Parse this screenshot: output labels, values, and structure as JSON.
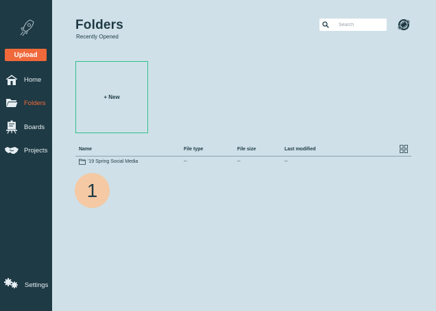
{
  "sidebar": {
    "logo": "rocket-icon",
    "upload_label": "Upload",
    "items": [
      {
        "label": "Home",
        "icon": "home-icon"
      },
      {
        "label": "Folders",
        "icon": "folder-icon",
        "active": true
      },
      {
        "label": "Boards",
        "icon": "board-icon"
      },
      {
        "label": "Projects",
        "icon": "handshake-icon"
      }
    ],
    "settings_label": "Settings"
  },
  "header": {
    "title": "Folders",
    "subtitle": "Recently Opened",
    "search_placeholder": "Search"
  },
  "new_card_label": "+ New",
  "table": {
    "columns": [
      "Name",
      "File type",
      "File size",
      "Last modified"
    ],
    "rows": [
      {
        "name": "'19 Spring Social Media",
        "type": "--",
        "size": "--",
        "modified": "--"
      }
    ]
  },
  "step_badge": "1",
  "colors": {
    "sidebar_bg": "#1e3a44",
    "accent": "#f0693a",
    "main_bg": "#cfe0e8",
    "card_border": "#2fbf8a",
    "badge_bg": "#f4c9a4"
  }
}
